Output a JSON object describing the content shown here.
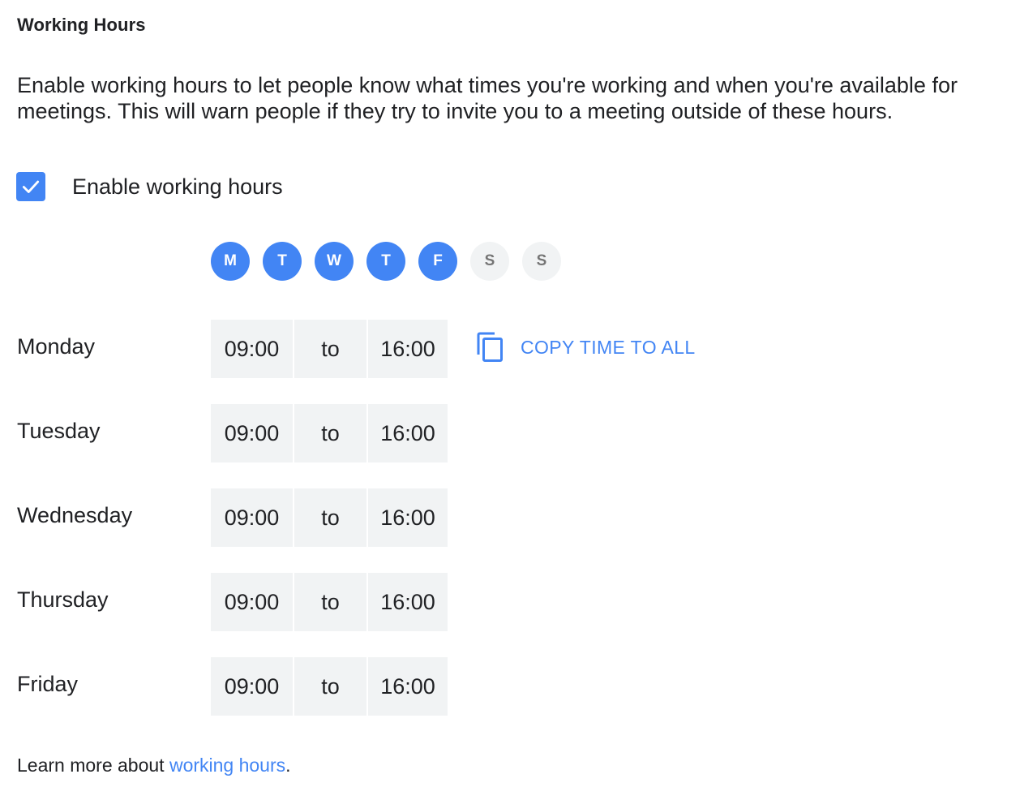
{
  "section": {
    "title": "Working Hours",
    "description": "Enable working hours to let people know what times you're working and when you're available for meetings. This will warn people if they try to invite you to a meeting outside of these hours."
  },
  "enable": {
    "label": "Enable working hours",
    "checked": true
  },
  "day_chips": [
    {
      "letter": "M",
      "active": true
    },
    {
      "letter": "T",
      "active": true
    },
    {
      "letter": "W",
      "active": true
    },
    {
      "letter": "T",
      "active": true
    },
    {
      "letter": "F",
      "active": true
    },
    {
      "letter": "S",
      "active": false
    },
    {
      "letter": "S",
      "active": false
    }
  ],
  "schedule": [
    {
      "day": "Monday",
      "start": "09:00",
      "separator": "to",
      "end": "16:00"
    },
    {
      "day": "Tuesday",
      "start": "09:00",
      "separator": "to",
      "end": "16:00"
    },
    {
      "day": "Wednesday",
      "start": "09:00",
      "separator": "to",
      "end": "16:00"
    },
    {
      "day": "Thursday",
      "start": "09:00",
      "separator": "to",
      "end": "16:00"
    },
    {
      "day": "Friday",
      "start": "09:00",
      "separator": "to",
      "end": "16:00"
    }
  ],
  "copy_button": {
    "label": "COPY TIME TO ALL",
    "icon": "copy-icon"
  },
  "footer": {
    "prefix": "Learn more about ",
    "link_text": "working hours",
    "suffix": "."
  },
  "colors": {
    "accent": "#4285f4",
    "inactive_chip_bg": "#f1f3f4",
    "inactive_chip_text": "#757575",
    "time_box_bg": "#f1f3f4",
    "text": "#202124"
  }
}
